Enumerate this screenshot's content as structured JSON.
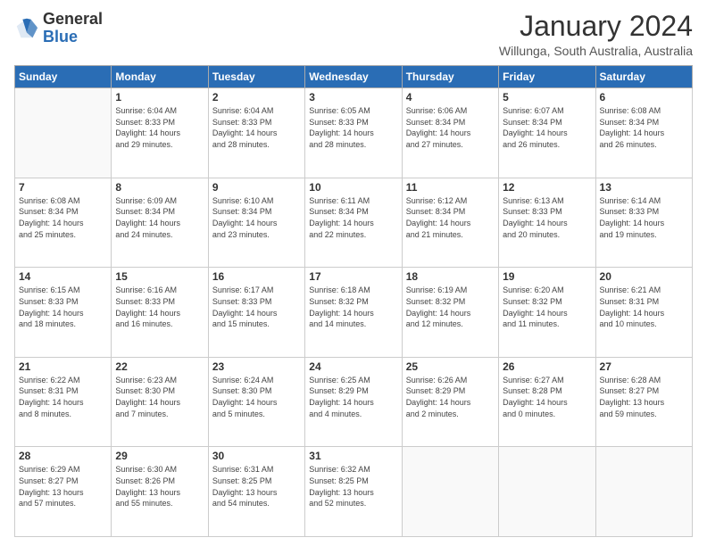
{
  "header": {
    "logo": {
      "general": "General",
      "blue": "Blue"
    },
    "title": "January 2024",
    "location": "Willunga, South Australia, Australia"
  },
  "calendar": {
    "days_of_week": [
      "Sunday",
      "Monday",
      "Tuesday",
      "Wednesday",
      "Thursday",
      "Friday",
      "Saturday"
    ],
    "weeks": [
      [
        {
          "day": "",
          "info": ""
        },
        {
          "day": "1",
          "info": "Sunrise: 6:04 AM\nSunset: 8:33 PM\nDaylight: 14 hours\nand 29 minutes."
        },
        {
          "day": "2",
          "info": "Sunrise: 6:04 AM\nSunset: 8:33 PM\nDaylight: 14 hours\nand 28 minutes."
        },
        {
          "day": "3",
          "info": "Sunrise: 6:05 AM\nSunset: 8:33 PM\nDaylight: 14 hours\nand 28 minutes."
        },
        {
          "day": "4",
          "info": "Sunrise: 6:06 AM\nSunset: 8:34 PM\nDaylight: 14 hours\nand 27 minutes."
        },
        {
          "day": "5",
          "info": "Sunrise: 6:07 AM\nSunset: 8:34 PM\nDaylight: 14 hours\nand 26 minutes."
        },
        {
          "day": "6",
          "info": "Sunrise: 6:08 AM\nSunset: 8:34 PM\nDaylight: 14 hours\nand 26 minutes."
        }
      ],
      [
        {
          "day": "7",
          "info": "Sunrise: 6:08 AM\nSunset: 8:34 PM\nDaylight: 14 hours\nand 25 minutes."
        },
        {
          "day": "8",
          "info": "Sunrise: 6:09 AM\nSunset: 8:34 PM\nDaylight: 14 hours\nand 24 minutes."
        },
        {
          "day": "9",
          "info": "Sunrise: 6:10 AM\nSunset: 8:34 PM\nDaylight: 14 hours\nand 23 minutes."
        },
        {
          "day": "10",
          "info": "Sunrise: 6:11 AM\nSunset: 8:34 PM\nDaylight: 14 hours\nand 22 minutes."
        },
        {
          "day": "11",
          "info": "Sunrise: 6:12 AM\nSunset: 8:34 PM\nDaylight: 14 hours\nand 21 minutes."
        },
        {
          "day": "12",
          "info": "Sunrise: 6:13 AM\nSunset: 8:33 PM\nDaylight: 14 hours\nand 20 minutes."
        },
        {
          "day": "13",
          "info": "Sunrise: 6:14 AM\nSunset: 8:33 PM\nDaylight: 14 hours\nand 19 minutes."
        }
      ],
      [
        {
          "day": "14",
          "info": "Sunrise: 6:15 AM\nSunset: 8:33 PM\nDaylight: 14 hours\nand 18 minutes."
        },
        {
          "day": "15",
          "info": "Sunrise: 6:16 AM\nSunset: 8:33 PM\nDaylight: 14 hours\nand 16 minutes."
        },
        {
          "day": "16",
          "info": "Sunrise: 6:17 AM\nSunset: 8:33 PM\nDaylight: 14 hours\nand 15 minutes."
        },
        {
          "day": "17",
          "info": "Sunrise: 6:18 AM\nSunset: 8:32 PM\nDaylight: 14 hours\nand 14 minutes."
        },
        {
          "day": "18",
          "info": "Sunrise: 6:19 AM\nSunset: 8:32 PM\nDaylight: 14 hours\nand 12 minutes."
        },
        {
          "day": "19",
          "info": "Sunrise: 6:20 AM\nSunset: 8:32 PM\nDaylight: 14 hours\nand 11 minutes."
        },
        {
          "day": "20",
          "info": "Sunrise: 6:21 AM\nSunset: 8:31 PM\nDaylight: 14 hours\nand 10 minutes."
        }
      ],
      [
        {
          "day": "21",
          "info": "Sunrise: 6:22 AM\nSunset: 8:31 PM\nDaylight: 14 hours\nand 8 minutes."
        },
        {
          "day": "22",
          "info": "Sunrise: 6:23 AM\nSunset: 8:30 PM\nDaylight: 14 hours\nand 7 minutes."
        },
        {
          "day": "23",
          "info": "Sunrise: 6:24 AM\nSunset: 8:30 PM\nDaylight: 14 hours\nand 5 minutes."
        },
        {
          "day": "24",
          "info": "Sunrise: 6:25 AM\nSunset: 8:29 PM\nDaylight: 14 hours\nand 4 minutes."
        },
        {
          "day": "25",
          "info": "Sunrise: 6:26 AM\nSunset: 8:29 PM\nDaylight: 14 hours\nand 2 minutes."
        },
        {
          "day": "26",
          "info": "Sunrise: 6:27 AM\nSunset: 8:28 PM\nDaylight: 14 hours\nand 0 minutes."
        },
        {
          "day": "27",
          "info": "Sunrise: 6:28 AM\nSunset: 8:27 PM\nDaylight: 13 hours\nand 59 minutes."
        }
      ],
      [
        {
          "day": "28",
          "info": "Sunrise: 6:29 AM\nSunset: 8:27 PM\nDaylight: 13 hours\nand 57 minutes."
        },
        {
          "day": "29",
          "info": "Sunrise: 6:30 AM\nSunset: 8:26 PM\nDaylight: 13 hours\nand 55 minutes."
        },
        {
          "day": "30",
          "info": "Sunrise: 6:31 AM\nSunset: 8:25 PM\nDaylight: 13 hours\nand 54 minutes."
        },
        {
          "day": "31",
          "info": "Sunrise: 6:32 AM\nSunset: 8:25 PM\nDaylight: 13 hours\nand 52 minutes."
        },
        {
          "day": "",
          "info": ""
        },
        {
          "day": "",
          "info": ""
        },
        {
          "day": "",
          "info": ""
        }
      ]
    ]
  }
}
